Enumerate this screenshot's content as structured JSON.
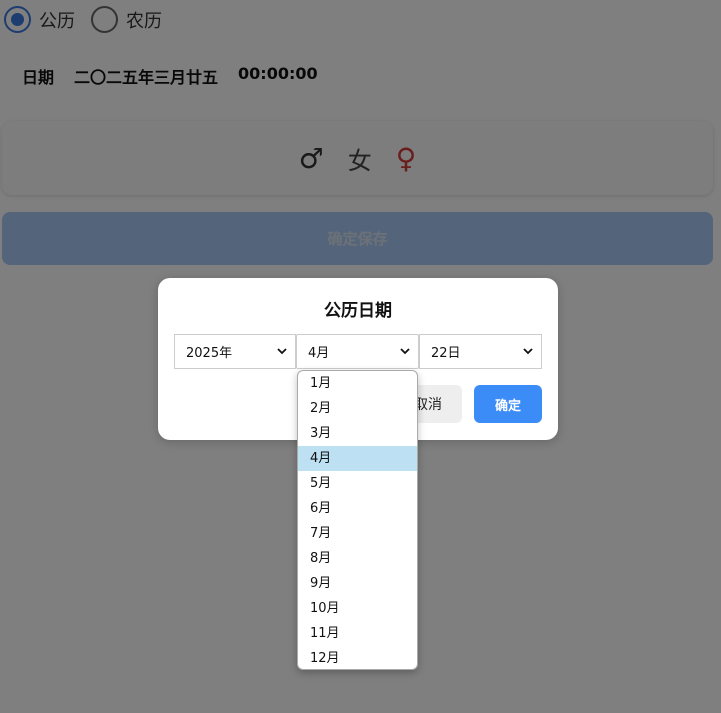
{
  "calendar_type": {
    "options": [
      {
        "label": "公历",
        "checked": true
      },
      {
        "label": "农历",
        "checked": false
      }
    ]
  },
  "date_display": {
    "label": "日期",
    "lunar_date": "二〇二五年三月廿五",
    "time": "00:00:00"
  },
  "gender": {
    "male_symbol": "♂",
    "female_text": "女",
    "female_symbol": "♀"
  },
  "save_button": {
    "label": "确定保存"
  },
  "dialog": {
    "title": "公历日期",
    "year_value": "2025年",
    "month_value": "4月",
    "day_value": "22日",
    "cancel_label": "取消",
    "ok_label": "确定"
  },
  "month_dropdown": {
    "options": [
      "1月",
      "2月",
      "3月",
      "4月",
      "5月",
      "6月",
      "7月",
      "8月",
      "9月",
      "10月",
      "11月",
      "12月"
    ],
    "selected_index": 3
  },
  "colors": {
    "accent": "#3c8cf7",
    "radio_checked": "#3a78e0",
    "female_symbol": "#d23a3a",
    "dropdown_highlight": "#bde1f3"
  }
}
